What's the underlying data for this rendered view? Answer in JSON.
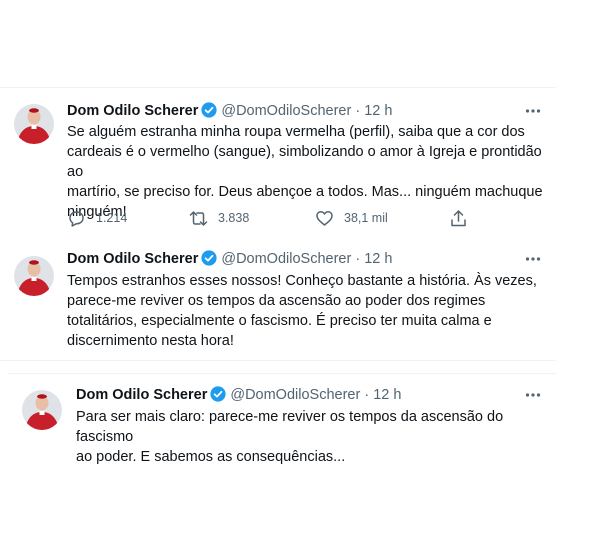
{
  "tweets": [
    {
      "name": "Dom Odilo Scherer",
      "handle": "@DomOdiloScherer",
      "separator": "·",
      "time": "12 h",
      "text_lines": [
        "Se alguém estranha minha roupa vermelha (perfil), saiba que a cor dos",
        "cardeais é o vermelho (sangue), simbolizando o amor à Igreja e prontidão ao",
        "martírio, se preciso for. Deus abençoe a todos. Mas... ninguém machuque",
        "ninguém!"
      ],
      "replies": "1.214",
      "retweets": "3.838",
      "likes": "38,1 mil"
    },
    {
      "name": "Dom Odilo Scherer",
      "handle": "@DomOdiloScherer",
      "separator": "·",
      "time": "12 h",
      "text_lines": [
        "Tempos estranhos esses nossos! Conheço bastante a história. Às vezes,",
        "parece-me reviver os tempos da ascensão ao poder dos regimes",
        "totalitários, especialmente o fascismo. É preciso ter muita calma e",
        "discernimento nesta hora!"
      ]
    },
    {
      "name": "Dom Odilo Scherer",
      "handle": "@DomOdiloScherer",
      "separator": "·",
      "time": "12 h",
      "text_lines": [
        "Para ser mais claro: parece-me reviver os tempos da ascensão do fascismo",
        "ao poder. E sabemos as consequências..."
      ]
    }
  ],
  "colors": {
    "verified": "#1d9bf0",
    "secondary_text": "#536471",
    "primary_text": "#0f1419",
    "cardinal_red": "#c8202a"
  },
  "icons": [
    "verified-badge-icon",
    "more-options-icon",
    "reply-icon",
    "retweet-icon",
    "like-icon",
    "share-icon"
  ]
}
